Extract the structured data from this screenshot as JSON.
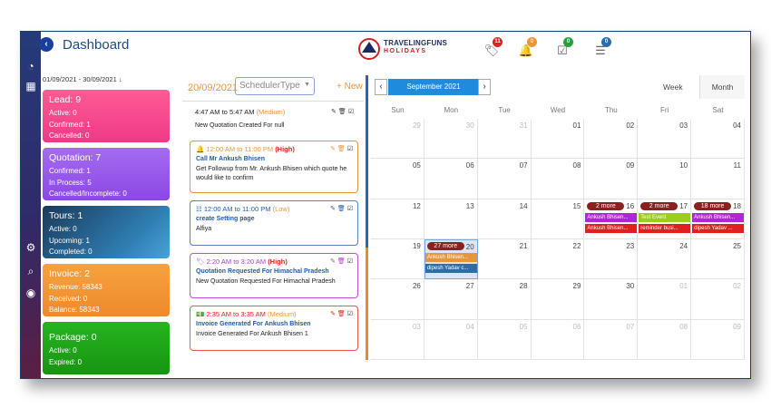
{
  "header": {
    "title": "Dashboard",
    "collapse_icon": "chevron-left-icon",
    "logo": {
      "brand": "TRAVELINGFUNS",
      "sub": "HOLIDAYS"
    }
  },
  "notifications": [
    {
      "icon": "tag-icon",
      "count": "11",
      "color": "#e02020"
    },
    {
      "icon": "bell-icon",
      "count": "0",
      "color": "#e8963a"
    },
    {
      "icon": "calendar-check-icon",
      "count": "0",
      "color": "#27a13a"
    },
    {
      "icon": "list-icon",
      "count": "0",
      "color": "#2b6ea8"
    }
  ],
  "date_range": "01/09/2021 - 30/09/2021",
  "cards": [
    {
      "title": "Lead: 9",
      "rows": [
        "Active: 0",
        "Confirmed: 1",
        "Cancelled: 0"
      ]
    },
    {
      "title": "Quotation: 7",
      "rows": [
        "Confirmed: 1",
        "In Process: 5",
        "Cancelled/Incomplete: 0"
      ]
    },
    {
      "title": "Tours: 1",
      "rows": [
        "Active: 0",
        "Upcoming: 1",
        "Completed: 0"
      ]
    },
    {
      "title": "Invoice: 2",
      "rows": [
        "Revenue: 58343",
        "Received: 0",
        "Balance: 58343"
      ]
    },
    {
      "title": "Package: 0",
      "rows": [
        "Active: 0",
        "Expired: 0"
      ]
    }
  ],
  "scheduler": {
    "date": "20/09/2021",
    "type_placeholder": "SchedulerType",
    "new_label": "+ New"
  },
  "events": [
    {
      "time": "4:47 AM to 5:47 AM",
      "priority": "(Medium)",
      "name": "",
      "desc": "New Quotation Created For null"
    },
    {
      "time": "12:00 AM to 11:00 PM",
      "priority": "(High)",
      "name": "Call Mr Ankush Bhisen",
      "desc": "Get Followup from Mr. Ankush Bhisen which quote he would like to confirm"
    },
    {
      "time": "12:00 AM to 11:00 PM",
      "priority": "(Low)",
      "name": "create Setting page",
      "desc": "Alfiya"
    },
    {
      "time": "2:20 AM to 3:20 AM",
      "priority": "(High)",
      "name": "Quotation Requested For Himachal Pradesh",
      "desc": "New Quotation Requested For Himachal Pradesh"
    },
    {
      "time": "2:35 AM to 3:35 AM",
      "priority": "(Medium)",
      "name": "Invoice Generated For Ankush Bhisen",
      "desc": "Invoice Generated For Ankush Bhisen 1"
    }
  ],
  "calendar": {
    "month_label": "September 2021",
    "week_label": "Week",
    "month_view_label": "Month",
    "days": [
      "Sun",
      "Mon",
      "Tue",
      "Wed",
      "Thu",
      "Fri",
      "Sat"
    ],
    "weeks": [
      [
        "29",
        "30",
        "31",
        "01",
        "02",
        "03",
        "04"
      ],
      [
        "05",
        "06",
        "07",
        "08",
        "09",
        "10",
        "11"
      ],
      [
        "12",
        "13",
        "14",
        "15",
        "16",
        "17",
        "18"
      ],
      [
        "19",
        "20",
        "21",
        "22",
        "23",
        "24",
        "25"
      ],
      [
        "26",
        "27",
        "28",
        "29",
        "30",
        "01",
        "02"
      ],
      [
        "03",
        "04",
        "05",
        "06",
        "07",
        "08",
        "09"
      ]
    ],
    "more_16": "2 more",
    "more_17": "2 more",
    "more_18": "18 more",
    "more_20": "27 more",
    "ev_16a": "Ankush Bhisen...",
    "ev_16b": "Ankush Bhisen...",
    "ev_17a": "Test Event",
    "ev_17b": "reminder busi...",
    "ev_18a": "Ankush Bhisen...",
    "ev_18b": "dipesh Yadav ...",
    "ev_20a": "Ankush Bhisen...",
    "ev_20b": "dipesh Yadav c..."
  }
}
